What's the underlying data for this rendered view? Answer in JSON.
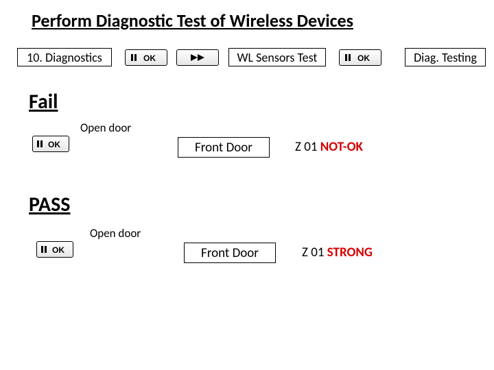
{
  "title": "Perform Diagnostic Test of Wireless Devices",
  "row1": {
    "left_box": "10. Diagnostics",
    "mid_box": "WL Sensors Test",
    "right_box": "Diag. Testing"
  },
  "fail": {
    "heading": "Fail",
    "open_door": "Open door",
    "front_door": "Front Door",
    "zone_prefix": "Z 01 ",
    "zone_status": "NOT-OK"
  },
  "pass": {
    "heading": "PASS",
    "open_door": "Open door",
    "front_door": "Front Door",
    "zone_prefix": "Z 01 ",
    "zone_status": "STRONG"
  }
}
